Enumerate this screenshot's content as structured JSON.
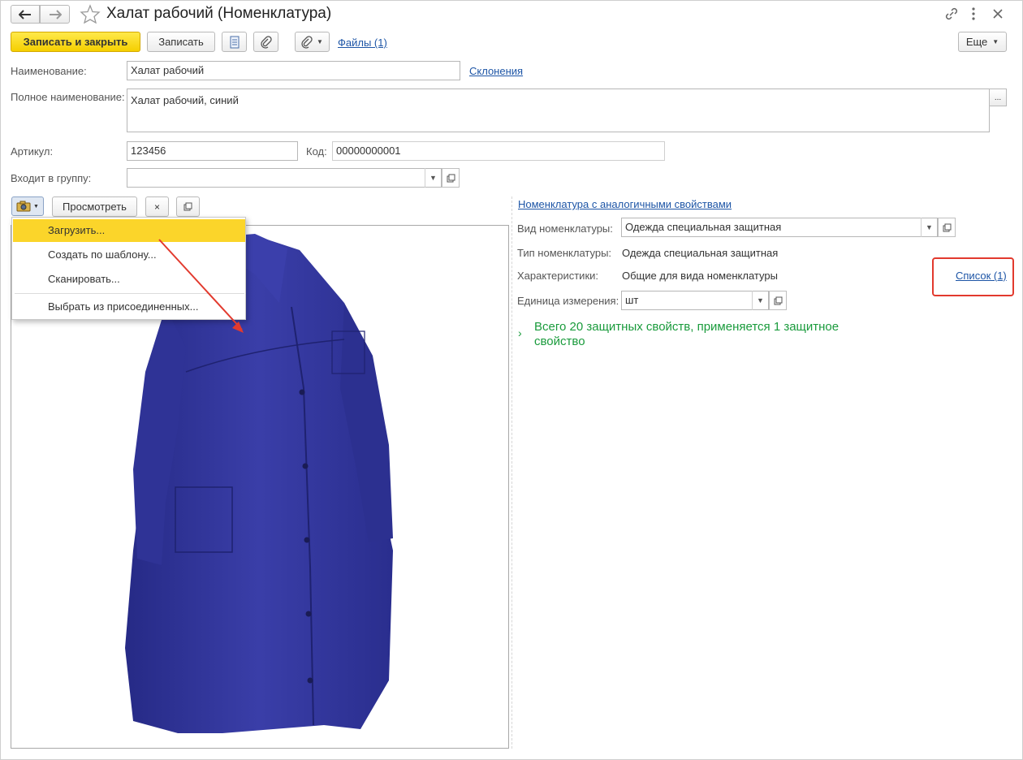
{
  "window": {
    "title": "Халат рабочий (Номенклатура)"
  },
  "toolbar": {
    "save_close": "Записать и закрыть",
    "save": "Записать",
    "files_link": "Файлы (1)",
    "more": "Еще"
  },
  "form": {
    "name_label": "Наименование:",
    "name_value": "Халат рабочий",
    "declension_link": "Склонения",
    "full_name_label": "Полное наименование:",
    "full_name_value": "Халат рабочий, синий",
    "ellipsis": "...",
    "article_label": "Артикул:",
    "article_value": "123456",
    "code_label": "Код:",
    "code_value": "00000000001",
    "group_label": "Входит в группу:",
    "group_value": ""
  },
  "image_panel": {
    "view_button": "Просмотреть",
    "clear_button": "×"
  },
  "image_menu": {
    "items": [
      {
        "label": "Загрузить..."
      },
      {
        "label": "Создать по шаблону..."
      },
      {
        "label": "Сканировать..."
      },
      {
        "label": "Выбрать из присоединенных..."
      }
    ]
  },
  "right_panel": {
    "similar_link": "Номенклатура с аналогичными свойствами",
    "kind_label": "Вид номенклатуры:",
    "kind_value": "Одежда специальная защитная",
    "type_label": "Тип номенклатуры:",
    "type_value": "Одежда специальная защитная",
    "chars_label": "Характеристики:",
    "chars_value": "Общие для вида номенклатуры",
    "chars_link": "Список (1)",
    "unit_label": "Единица измерения:",
    "unit_value": "шт",
    "protective_line1": "Всего 20 защитных свойств, применяется 1 защитное",
    "protective_line2": "свойство"
  },
  "colors": {
    "accent_yellow": "#fbd52a",
    "link_blue": "#1d55a6",
    "green_text": "#1a9b3c",
    "annotation_red": "#e23a2e",
    "coat_blue": "#33369c"
  }
}
